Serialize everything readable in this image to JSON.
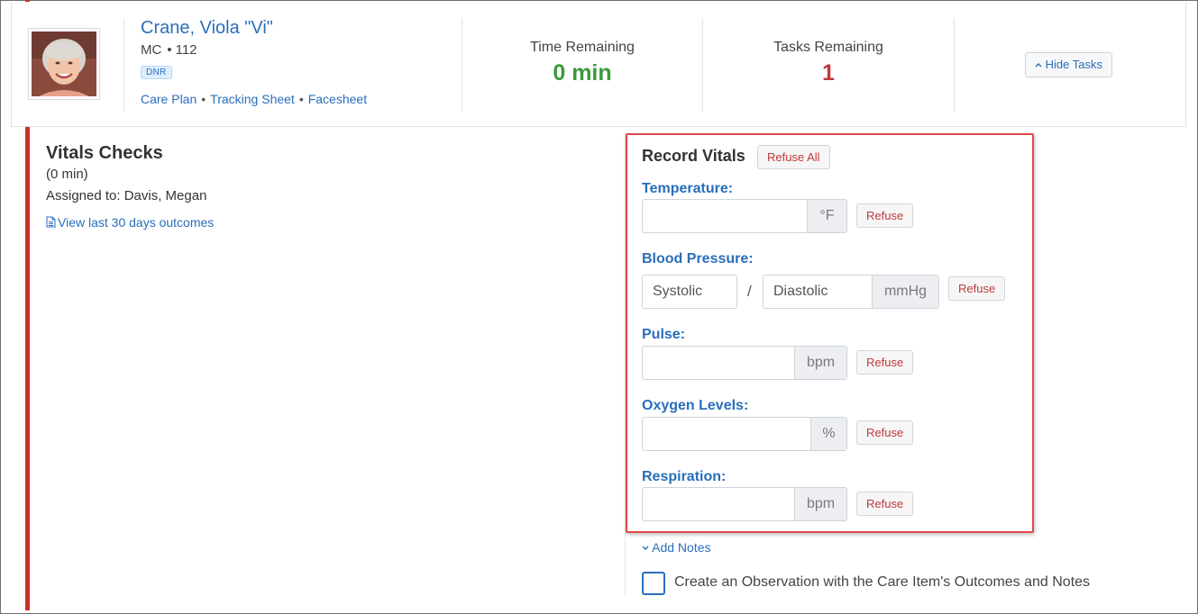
{
  "resident": {
    "name": "Crane, Viola \"Vi\"",
    "unit_code": "MC",
    "room": "112",
    "badge": "DNR",
    "links": [
      "Care Plan",
      "Tracking Sheet",
      "Facesheet"
    ]
  },
  "stats": {
    "time_label": "Time Remaining",
    "time_value": "0 min",
    "tasks_label": "Tasks Remaining",
    "tasks_value": "1"
  },
  "hide_tasks_label": "Hide Tasks",
  "task": {
    "title": "Vitals Checks",
    "duration": "(0 min)",
    "assigned": "Assigned to: Davis, Megan",
    "outcomes_link": "View last 30 days outcomes"
  },
  "vitals": {
    "title": "Record Vitals",
    "refuse_all": "Refuse All",
    "refuse": "Refuse",
    "temperature": {
      "label": "Temperature:",
      "unit": "°F",
      "value": ""
    },
    "blood_pressure": {
      "label": "Blood Pressure:",
      "systolic_placeholder": "Systolic",
      "diastolic_placeholder": "Diastolic",
      "separator": "/",
      "unit": "mmHg"
    },
    "pulse": {
      "label": "Pulse:",
      "unit": "bpm",
      "value": ""
    },
    "oxygen": {
      "label": "Oxygen Levels:",
      "unit": "%",
      "value": ""
    },
    "respiration": {
      "label": "Respiration:",
      "unit": "bpm",
      "value": ""
    }
  },
  "add_notes": "Add Notes",
  "observation": {
    "label": "Create an Observation with the Care Item's Outcomes and Notes",
    "checked": false
  },
  "colors": {
    "link": "#2a6ebb",
    "time_green": "#3a9a3a",
    "tasks_red": "#c0393b",
    "highlight_border": "#e04848",
    "task_bar": "#c9302c"
  }
}
